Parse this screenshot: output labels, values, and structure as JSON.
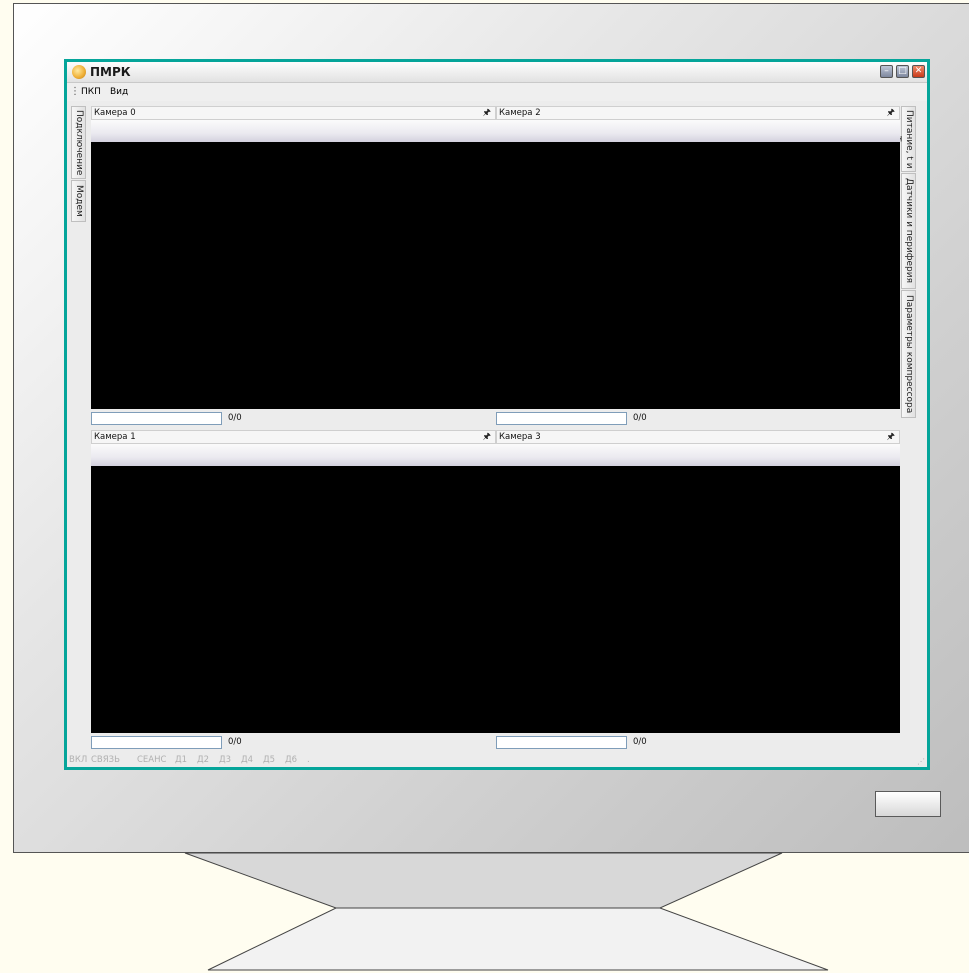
{
  "window": {
    "title": "ПМРК",
    "minimize": "–",
    "maximize": "□",
    "close": "✕"
  },
  "menu": {
    "grip": "⋮",
    "items": [
      "ПКП",
      "Вид"
    ]
  },
  "left_tabs": [
    "Подключение",
    "Модем"
  ],
  "right_tabs": [
    "Питание, t и T",
    "Датчики и периферия",
    "Параметры компрессора"
  ],
  "cameras": [
    {
      "title": "Камера 0",
      "counter": "0/0"
    },
    {
      "title": "Камера 2",
      "counter": "0/0"
    },
    {
      "title": "Камера 1",
      "counter": "0/0"
    },
    {
      "title": "Камера 3",
      "counter": "0/0"
    }
  ],
  "pin_icon": "🖈",
  "status": {
    "items": [
      "ВКЛ",
      "СВЯЗЬ",
      "СЕАНС",
      "Д1",
      "Д2",
      "Д3",
      "Д4",
      "Д5",
      "Д6"
    ],
    "trailing": ".",
    "grip": "⋰"
  },
  "colors": {
    "window_border": "#05a59a",
    "video_background": "#000000",
    "status_inactive": "#b0b0b0"
  }
}
